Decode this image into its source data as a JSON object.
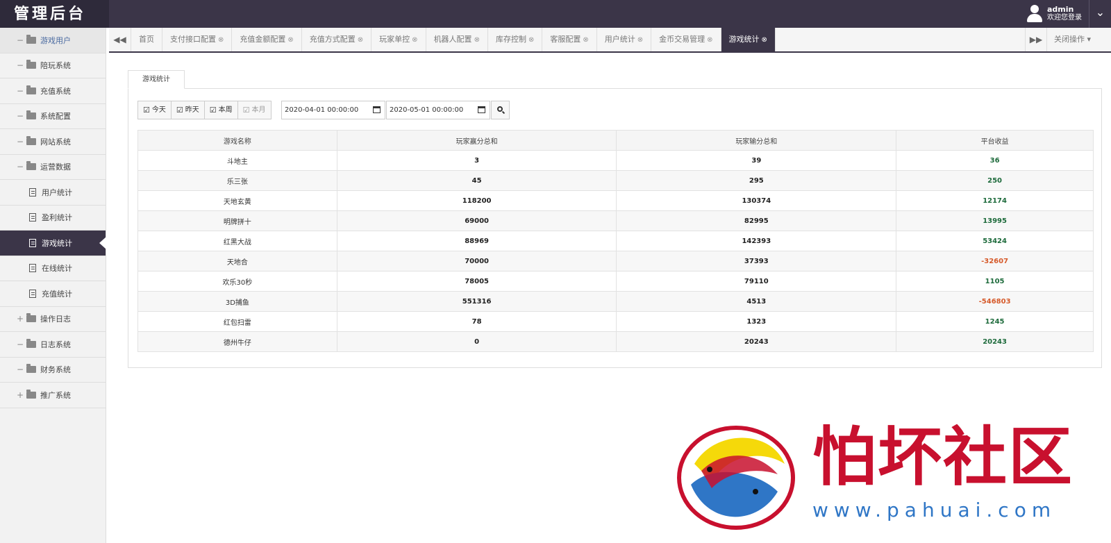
{
  "app": {
    "logo": "管理后台"
  },
  "user": {
    "name": "admin",
    "welcome": "欢迎您登录",
    "menu_icon": "chevron-down-icon"
  },
  "sidebar": {
    "items": [
      {
        "label": "游戏用户",
        "toggle": "−",
        "highlight": true
      },
      {
        "label": "陪玩系统",
        "toggle": "−"
      },
      {
        "label": "充值系统",
        "toggle": "−"
      },
      {
        "label": "系统配置",
        "toggle": "−"
      },
      {
        "label": "网站系统",
        "toggle": "−"
      },
      {
        "label": "运营数据",
        "toggle": "−"
      },
      {
        "label": "用户统计",
        "sub": true
      },
      {
        "label": "盈利统计",
        "sub": true
      },
      {
        "label": "游戏统计",
        "sub": true,
        "active": true
      },
      {
        "label": "在线统计",
        "sub": true
      },
      {
        "label": "充值统计",
        "sub": true
      },
      {
        "label": "操作日志",
        "toggle": "+"
      },
      {
        "label": "日志系统",
        "toggle": "−"
      },
      {
        "label": "财务系统",
        "toggle": "−"
      },
      {
        "label": "推广系统",
        "toggle": "+"
      }
    ]
  },
  "tabs": {
    "prev_icon": "double-left-icon",
    "next_icon": "double-right-icon",
    "close_ops": "关闭操作 ▾",
    "items": [
      {
        "label": "首页",
        "closable": false
      },
      {
        "label": "支付接口配置",
        "closable": true
      },
      {
        "label": "充值金额配置",
        "closable": true
      },
      {
        "label": "充值方式配置",
        "closable": true
      },
      {
        "label": "玩家单控",
        "closable": true
      },
      {
        "label": "机器人配置",
        "closable": true
      },
      {
        "label": "库存控制",
        "closable": true
      },
      {
        "label": "客服配置",
        "closable": true
      },
      {
        "label": "用户统计",
        "closable": true
      },
      {
        "label": "金币交易管理",
        "closable": true
      },
      {
        "label": "游戏统计",
        "closable": true,
        "active": true
      }
    ]
  },
  "panel": {
    "tab_label": "游戏统计",
    "quick": [
      {
        "label": "今天",
        "disabled": false
      },
      {
        "label": "昨天",
        "disabled": false
      },
      {
        "label": "本周",
        "disabled": false
      },
      {
        "label": "本月",
        "disabled": true
      }
    ],
    "date_from": "2020-04-01 00:00:00",
    "date_to": "2020-05-01 00:00:00"
  },
  "table": {
    "headers": [
      "游戏名称",
      "玩家赢分总和",
      "玩家输分总和",
      "平台收益"
    ],
    "rows": [
      [
        "斗地主",
        "3",
        "39",
        "36"
      ],
      [
        "乐三张",
        "45",
        "295",
        "250"
      ],
      [
        "天地玄黄",
        "118200",
        "130374",
        "12174"
      ],
      [
        "明牌拼十",
        "69000",
        "82995",
        "13995"
      ],
      [
        "红黑大战",
        "88969",
        "142393",
        "53424"
      ],
      [
        "天地合",
        "70000",
        "37393",
        "-32607"
      ],
      [
        "欢乐30秒",
        "78005",
        "79110",
        "1105"
      ],
      [
        "3D捕鱼",
        "551316",
        "4513",
        "-546803"
      ],
      [
        "红包扫雷",
        "78",
        "1323",
        "1245"
      ],
      [
        "德州牛仔",
        "0",
        "20243",
        "20243"
      ]
    ]
  },
  "watermark": {
    "text": "怕坏社区",
    "url": "www.pahuai.com"
  },
  "colors": {
    "header": "#3b3548",
    "positive": "#1e6b3c",
    "negative": "#d65a2a",
    "watermark_red": "#c8102e",
    "watermark_blue": "#2f76c6"
  }
}
